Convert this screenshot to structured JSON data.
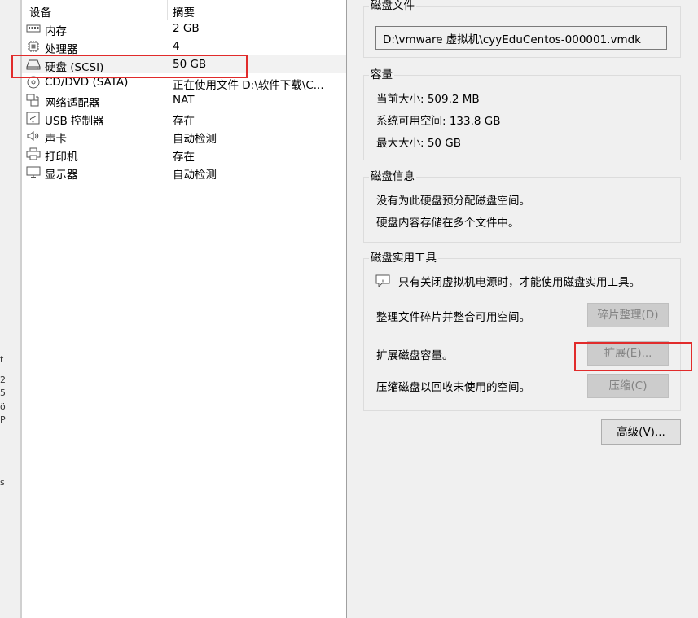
{
  "device_list": {
    "columns": {
      "device": "设备",
      "summary": "摘要"
    },
    "items": [
      {
        "icon": "memory-icon",
        "name": "内存",
        "summary": "2 GB"
      },
      {
        "icon": "processor-icon",
        "name": "处理器",
        "summary": "4"
      },
      {
        "icon": "hard-disk-icon",
        "name": "硬盘 (SCSI)",
        "summary": "50 GB",
        "selected": true
      },
      {
        "icon": "cd-dvd-icon",
        "name": "CD/DVD (SATA)",
        "summary": "正在使用文件 D:\\软件下载\\C..."
      },
      {
        "icon": "network-adapter-icon",
        "name": "网络适配器",
        "summary": "NAT"
      },
      {
        "icon": "usb-icon",
        "name": "USB 控制器",
        "summary": "存在"
      },
      {
        "icon": "sound-card-icon",
        "name": "声卡",
        "summary": "自动检测"
      },
      {
        "icon": "printer-icon",
        "name": "打印机",
        "summary": "存在"
      },
      {
        "icon": "display-icon",
        "name": "显示器",
        "summary": "自动检测"
      }
    ]
  },
  "disk_file": {
    "title": "磁盘文件",
    "path": "D:\\vmware 虚拟机\\cyyEduCentos-000001.vmdk"
  },
  "capacity": {
    "title": "容量",
    "current_size": "当前大小: 509.2 MB",
    "available_space": "系统可用空间: 133.8 GB",
    "max_size": "最大大小: 50 GB"
  },
  "disk_info": {
    "title": "磁盘信息",
    "line1": "没有为此硬盘预分配磁盘空间。",
    "line2": "硬盘内容存储在多个文件中。"
  },
  "disk_utilities": {
    "title": "磁盘实用工具",
    "notice": "只有关闭虚拟机电源时，才能使用磁盘实用工具。",
    "defrag_text": "整理文件碎片并整合可用空间。",
    "defrag_button": "碎片整理(D)",
    "expand_text": "扩展磁盘容量。",
    "expand_button": "扩展(E)...",
    "compact_text": "压缩磁盘以回收未使用的空间。",
    "compact_button": "压缩(C)"
  },
  "advanced_button": "高级(V)...",
  "left_strip_glyphs": [
    "t",
    "2",
    "5",
    "ö",
    "P",
    "s"
  ],
  "colors": {
    "highlight": "#e12b2b",
    "disabled_button_bg": "#cccccc"
  }
}
